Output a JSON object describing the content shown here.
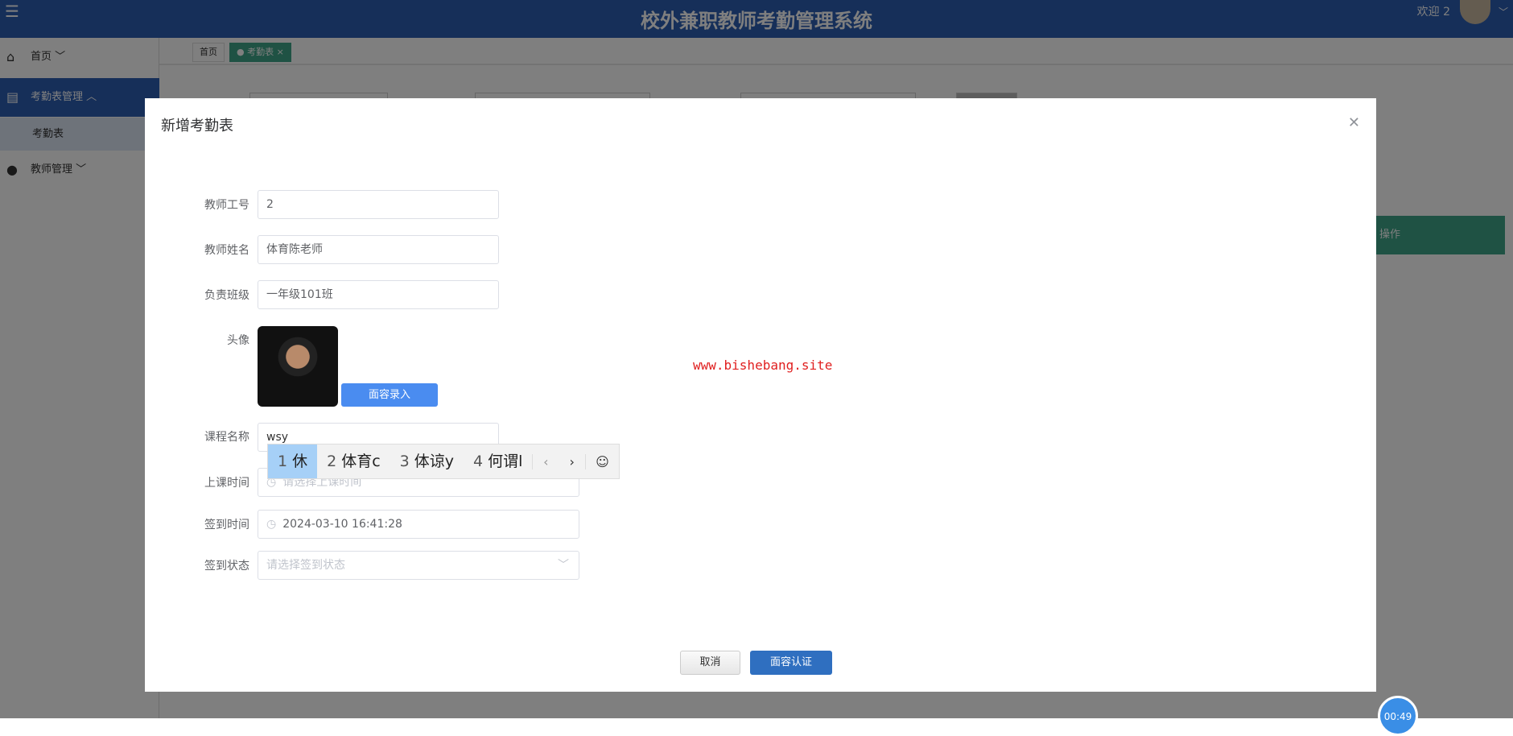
{
  "header": {
    "title": "校外兼职教师考勤管理系统",
    "welcome": "欢迎 2"
  },
  "sidebar": {
    "items": [
      {
        "label": "首页 ﹀"
      },
      {
        "label": "考勤表管理 ︿"
      },
      {
        "label": "考勤表"
      },
      {
        "label": "教师管理 ﹀"
      }
    ]
  },
  "tabs": [
    {
      "label": "首页"
    },
    {
      "label": "● 考勤表 ×"
    }
  ],
  "background": {
    "ops_header": "操作"
  },
  "modal": {
    "title": "新增考勤表",
    "fields": {
      "teacher_id": {
        "label": "教师工号",
        "value": "2"
      },
      "teacher_name": {
        "label": "教师姓名",
        "value": "体育陈老师"
      },
      "class": {
        "label": "负责班级",
        "value": "一年级101班"
      },
      "avatar": {
        "label": "头像",
        "button": "面容录入"
      },
      "course": {
        "label": "课程名称",
        "value": "wsy"
      },
      "class_time": {
        "label": "上课时间",
        "placeholder": "请选择上课时间"
      },
      "sign_time": {
        "label": "签到时间",
        "value": "2024-03-10 16:41:28"
      },
      "sign_status": {
        "label": "签到状态",
        "placeholder": "请选择签到状态"
      }
    },
    "cancel": "取消",
    "confirm": "面容认证"
  },
  "ime": {
    "candidates": [
      {
        "n": "1",
        "t": "休"
      },
      {
        "n": "2",
        "t": "体育c"
      },
      {
        "n": "3",
        "t": "体谅y"
      },
      {
        "n": "4",
        "t": "何谓l"
      }
    ]
  },
  "watermark": "www.bishebang.site",
  "timer": "00:49"
}
